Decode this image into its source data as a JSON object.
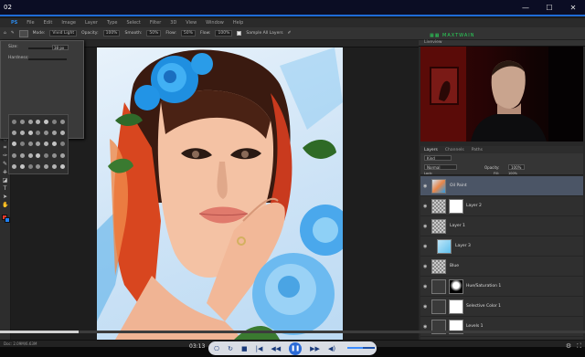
{
  "window": {
    "title": "02",
    "minimize": "—",
    "maximize": "☐",
    "close": "✕"
  },
  "menu": [
    "PS",
    "File",
    "Edit",
    "Image",
    "Layer",
    "Type",
    "Select",
    "Filter",
    "3D",
    "View",
    "Window",
    "Help"
  ],
  "options": {
    "mode_label": "Mode:",
    "mode_value": "Vivid Light",
    "opacity_label": "Opacity:",
    "opacity_value": "100%",
    "flow_label": "Smooth:",
    "flow_value": "50%",
    "smooth_label": "Flow:",
    "smooth_value": "50%",
    "pressure_label": "Flow:",
    "pressure_value": "100%",
    "sample_label": "Sample All Layers"
  },
  "brush_panel": {
    "size_label": "Size:",
    "size_value": "38 px",
    "hardness_label": "Hardness:",
    "preset_count": 35
  },
  "canvas_tab": "Untitled-1 @ 66.7% (Oil Paint, RGB/8)",
  "logo": "MAXTWAIN",
  "camera_panel": {
    "tab": "Liveview"
  },
  "panel_tabs": [
    "Layers",
    "Channels",
    "Paths"
  ],
  "layer_controls": {
    "kind": "Kind",
    "blend": "Normal",
    "opacity_label": "Opacity:",
    "opacity_value": "100%",
    "lock_label": "Lock:",
    "fill_label": "Fill:",
    "fill_value": "100%"
  },
  "layers": [
    {
      "name": "Oil Paint",
      "type": "image",
      "selected": true
    },
    {
      "name": "Layer 2",
      "type": "masked",
      "selected": false
    },
    {
      "name": "Layer 1",
      "type": "plain",
      "selected": false
    },
    {
      "name": "Layer 3",
      "type": "plain",
      "selected": false
    },
    {
      "name": "Blue",
      "type": "plain",
      "selected": false
    },
    {
      "name": "Hue/Saturation 1",
      "type": "adjust",
      "selected": false
    },
    {
      "name": "Selective Color 1",
      "type": "adjust",
      "selected": false
    },
    {
      "name": "Levels 1",
      "type": "adjust",
      "selected": false
    }
  ],
  "status": {
    "zoom": "Doc: 2.09M/6.63M"
  },
  "player": {
    "time": "03:13",
    "progress": 0.134,
    "volume": 0.55
  },
  "colors": {
    "accent": "#1e6bd6",
    "foreground": "#e8382a",
    "background": "#1e7ef0",
    "logo": "#2bd35a"
  }
}
